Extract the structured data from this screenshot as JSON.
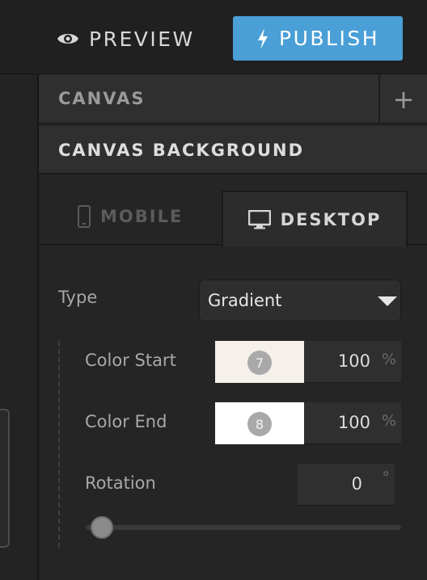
{
  "topbar": {
    "preview_label": "PREVIEW",
    "publish_label": "PUBLISH",
    "preview_icon": "eye-icon",
    "publish_icon": "lightning-icon",
    "publish_color": "#4a9fd6"
  },
  "panel": {
    "canvas_label": "CANVAS",
    "add_icon": "plus-icon",
    "add_label": "+",
    "background_label": "CANVAS BACKGROUND"
  },
  "tabs": [
    {
      "label": "MOBILE",
      "icon": "phone-icon",
      "active": false
    },
    {
      "label": "DESKTOP",
      "icon": "monitor-icon",
      "active": true
    }
  ],
  "form": {
    "type_label": "Type",
    "type_value": "Gradient",
    "color_start": {
      "label": "Color Start",
      "swatch_color": "#f5f1ea",
      "badge": "7",
      "value": "100",
      "unit": "%"
    },
    "color_end": {
      "label": "Color End",
      "swatch_color": "#ffffff",
      "badge": "8",
      "value": "100",
      "unit": "%"
    },
    "rotation": {
      "label": "Rotation",
      "value": "0",
      "unit": "°",
      "slider_level": 0
    }
  }
}
